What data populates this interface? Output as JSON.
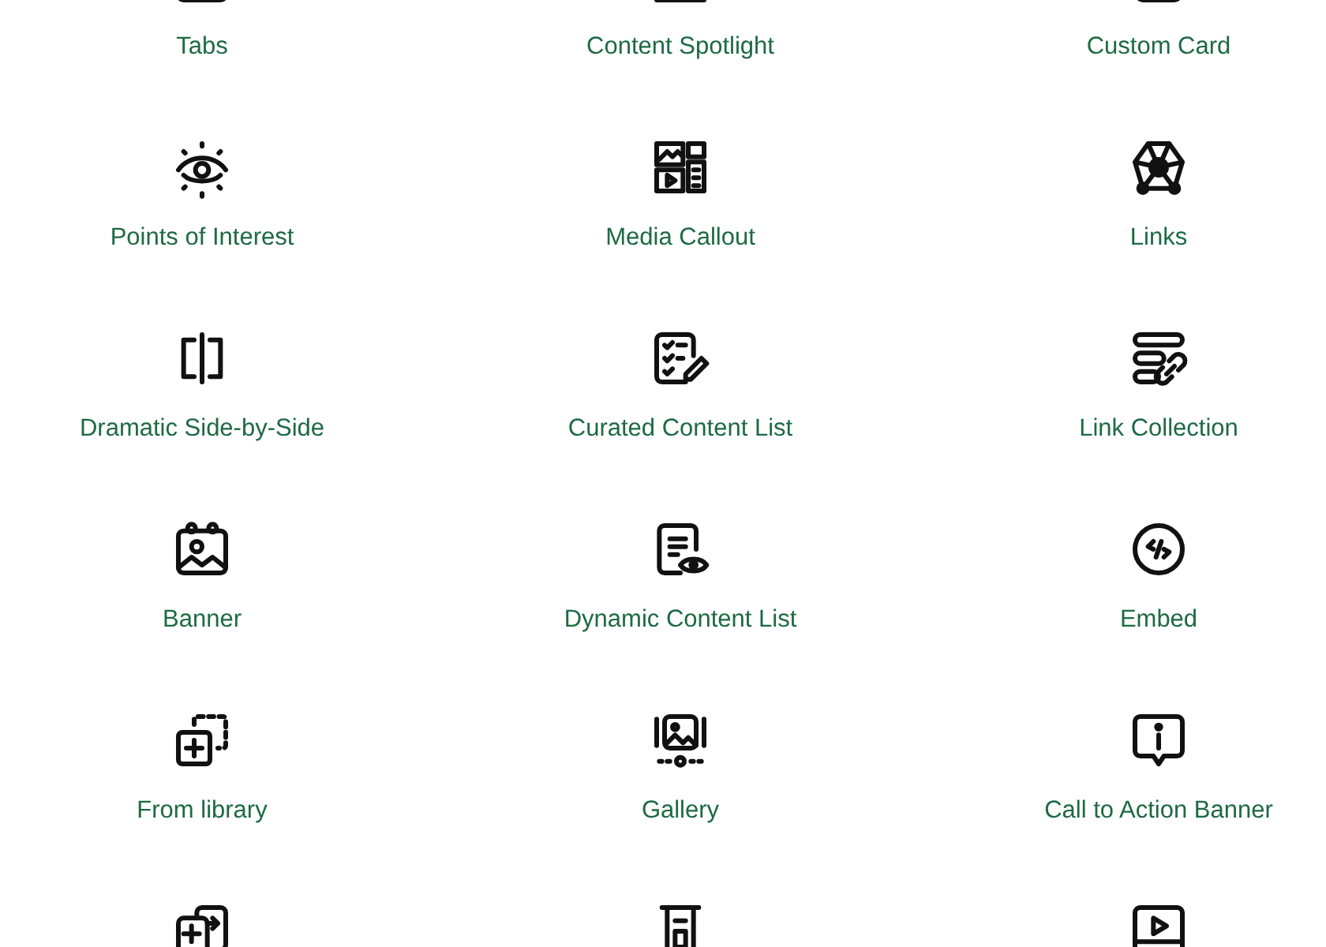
{
  "blocks": [
    {
      "label": "Tabs"
    },
    {
      "label": "Content Spotlight"
    },
    {
      "label": "Custom Card"
    },
    {
      "label": "Points of Interest"
    },
    {
      "label": "Media Callout"
    },
    {
      "label": "Links"
    },
    {
      "label": "Dramatic Side-by-Side"
    },
    {
      "label": "Curated Content List"
    },
    {
      "label": "Link Collection"
    },
    {
      "label": "Banner"
    },
    {
      "label": "Dynamic Content List"
    },
    {
      "label": "Embed"
    },
    {
      "label": "From library"
    },
    {
      "label": "Gallery"
    },
    {
      "label": "Call to Action Banner"
    }
  ]
}
